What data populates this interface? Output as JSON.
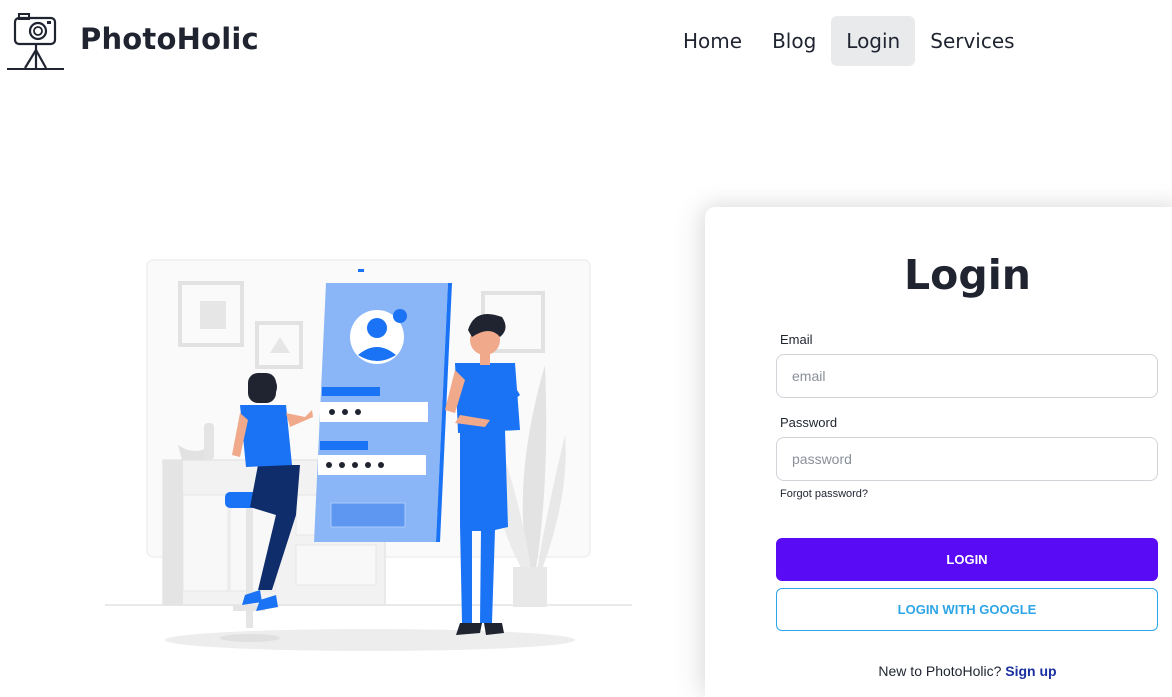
{
  "header": {
    "brand": "PhotoHolic",
    "logo_icon": "camera-tripod-icon",
    "nav": [
      {
        "label": "Home",
        "active": false
      },
      {
        "label": "Blog",
        "active": false
      },
      {
        "label": "Login",
        "active": true
      },
      {
        "label": "Services",
        "active": false
      }
    ]
  },
  "illustration": {
    "icon": "login-illustration",
    "colors": {
      "primary": "#1a73f5",
      "light": "#8ab6f8",
      "dark": "#0f2d6b",
      "grey": "#e6e6e6"
    }
  },
  "login": {
    "title": "Login",
    "email_label": "Email",
    "email_placeholder": "email",
    "password_label": "Password",
    "password_placeholder": "password",
    "forgot": "Forgot password?",
    "login_button": "LOGIN",
    "google_button": "LOGIN WITH GOOGLE",
    "signup_prompt": "New to PhotoHolic?",
    "signup_link": "Sign up"
  },
  "colors": {
    "accent": "#5a0bf5",
    "google": "#2ea5e6",
    "signup": "#1a2fa0",
    "nav_active_bg": "#e9eaec"
  }
}
